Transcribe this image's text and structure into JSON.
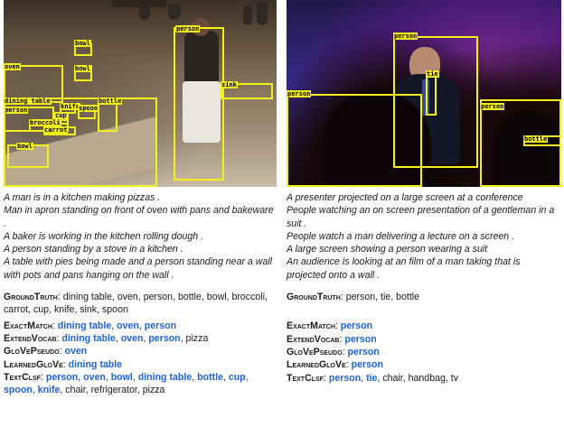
{
  "left": {
    "detections": [
      "bowl",
      "oven",
      "bowl",
      "person",
      "person",
      "dining table",
      "bottle",
      "sink",
      "knife",
      "cup",
      "spoon",
      "broccoli",
      "carrot",
      "bowl"
    ],
    "captions": [
      "A man is in a kitchen making pizzas .",
      "Man in apron standing on front of oven with pans and bakeware .",
      "A baker is working in the kitchen rolling dough .",
      "A person standing by a stove in a kitchen .",
      "A table with pies being made and a person standing near a wall with pots and pans hanging on the wall ."
    ],
    "results": [
      {
        "method": "GroundTruth",
        "items": [
          {
            "text": "dining table",
            "match": false
          },
          {
            "text": "oven",
            "match": false
          },
          {
            "text": "person",
            "match": false
          },
          {
            "text": "bottle",
            "match": false
          },
          {
            "text": "bowl",
            "match": false
          },
          {
            "text": "broccoli",
            "match": false
          },
          {
            "text": "carrot",
            "match": false
          },
          {
            "text": "cup",
            "match": false
          },
          {
            "text": "knife",
            "match": false
          },
          {
            "text": "sink",
            "match": false
          },
          {
            "text": "spoon",
            "match": false
          }
        ]
      },
      {
        "method": "ExactMatch",
        "items": [
          {
            "text": "dining table",
            "match": true
          },
          {
            "text": "oven",
            "match": true
          },
          {
            "text": "person",
            "match": true
          }
        ]
      },
      {
        "method": "ExtendVocab",
        "items": [
          {
            "text": "dining table",
            "match": true
          },
          {
            "text": "oven",
            "match": true
          },
          {
            "text": "person",
            "match": true
          },
          {
            "text": "pizza",
            "match": false
          }
        ]
      },
      {
        "method": "GloVePseudo",
        "items": [
          {
            "text": "oven",
            "match": true
          }
        ]
      },
      {
        "method": "LearnedGloVe",
        "items": [
          {
            "text": "dining table",
            "match": true
          }
        ]
      },
      {
        "method": "TextClsf",
        "items": [
          {
            "text": "person",
            "match": true
          },
          {
            "text": "oven",
            "match": true
          },
          {
            "text": "bowl",
            "match": true
          },
          {
            "text": "dining table",
            "match": true
          },
          {
            "text": "bottle",
            "match": true
          },
          {
            "text": "cup",
            "match": true
          },
          {
            "text": "spoon",
            "match": true
          },
          {
            "text": "knife",
            "match": true
          },
          {
            "text": "chair",
            "match": false
          },
          {
            "text": "refrigerator",
            "match": false
          },
          {
            "text": "pizza",
            "match": false
          }
        ]
      }
    ]
  },
  "right": {
    "detections": [
      "person",
      "tie",
      "person",
      "person",
      "bottle"
    ],
    "captions": [
      "A presenter projected on a large screen at a conference",
      "People watching an on screen presentation of a gentleman in a suit .",
      "People watch a man delivering a lecture on a screen .",
      "A large screen showing a person wearing a suit",
      "An audience is looking at an film of a man taking that is projected onto a wall ."
    ],
    "results": [
      {
        "method": "GroundTruth",
        "items": [
          {
            "text": "person",
            "match": false
          },
          {
            "text": "tie",
            "match": false
          },
          {
            "text": "bottle",
            "match": false
          }
        ]
      },
      {
        "method": "ExactMatch",
        "items": [
          {
            "text": "person",
            "match": true
          }
        ]
      },
      {
        "method": "ExtendVocab",
        "items": [
          {
            "text": "person",
            "match": true
          }
        ]
      },
      {
        "method": "GloVePseudo",
        "items": [
          {
            "text": "person",
            "match": true
          }
        ]
      },
      {
        "method": "LearnedGloVe",
        "items": [
          {
            "text": "person",
            "match": true
          }
        ]
      },
      {
        "method": "TextClsf",
        "items": [
          {
            "text": "person",
            "match": true
          },
          {
            "text": "tie",
            "match": true
          },
          {
            "text": "chair",
            "match": false
          },
          {
            "text": "handbag",
            "match": false
          },
          {
            "text": "tv",
            "match": false
          }
        ]
      }
    ]
  },
  "colors": {
    "box": "#f4ee1a",
    "match": "#1f63d8"
  }
}
